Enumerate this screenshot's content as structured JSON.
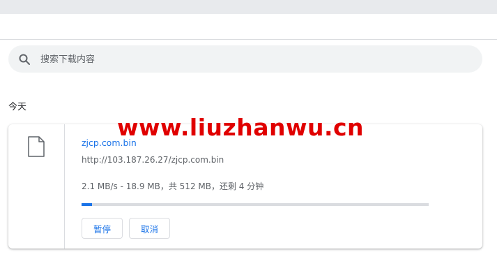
{
  "search": {
    "placeholder": "搜索下载内容",
    "icon": "search-icon"
  },
  "section": {
    "label": "今天"
  },
  "download": {
    "file_icon": "file-icon",
    "filename": "zjcp.com.bin",
    "url": "http://103.187.26.27/zjcp.com.bin",
    "status": "2.1 MB/s - 18.9 MB，共 512 MB，还剩 4 分钟",
    "progress_fraction": 0.03,
    "pause_label": "暂停",
    "cancel_label": "取消"
  },
  "watermark": {
    "text": "www.liuzhanwu.cn"
  },
  "colors": {
    "accent": "#1a73e8",
    "watermark": "#e00000",
    "topbar": "#e8eaed",
    "search_bg": "#f1f3f4"
  }
}
